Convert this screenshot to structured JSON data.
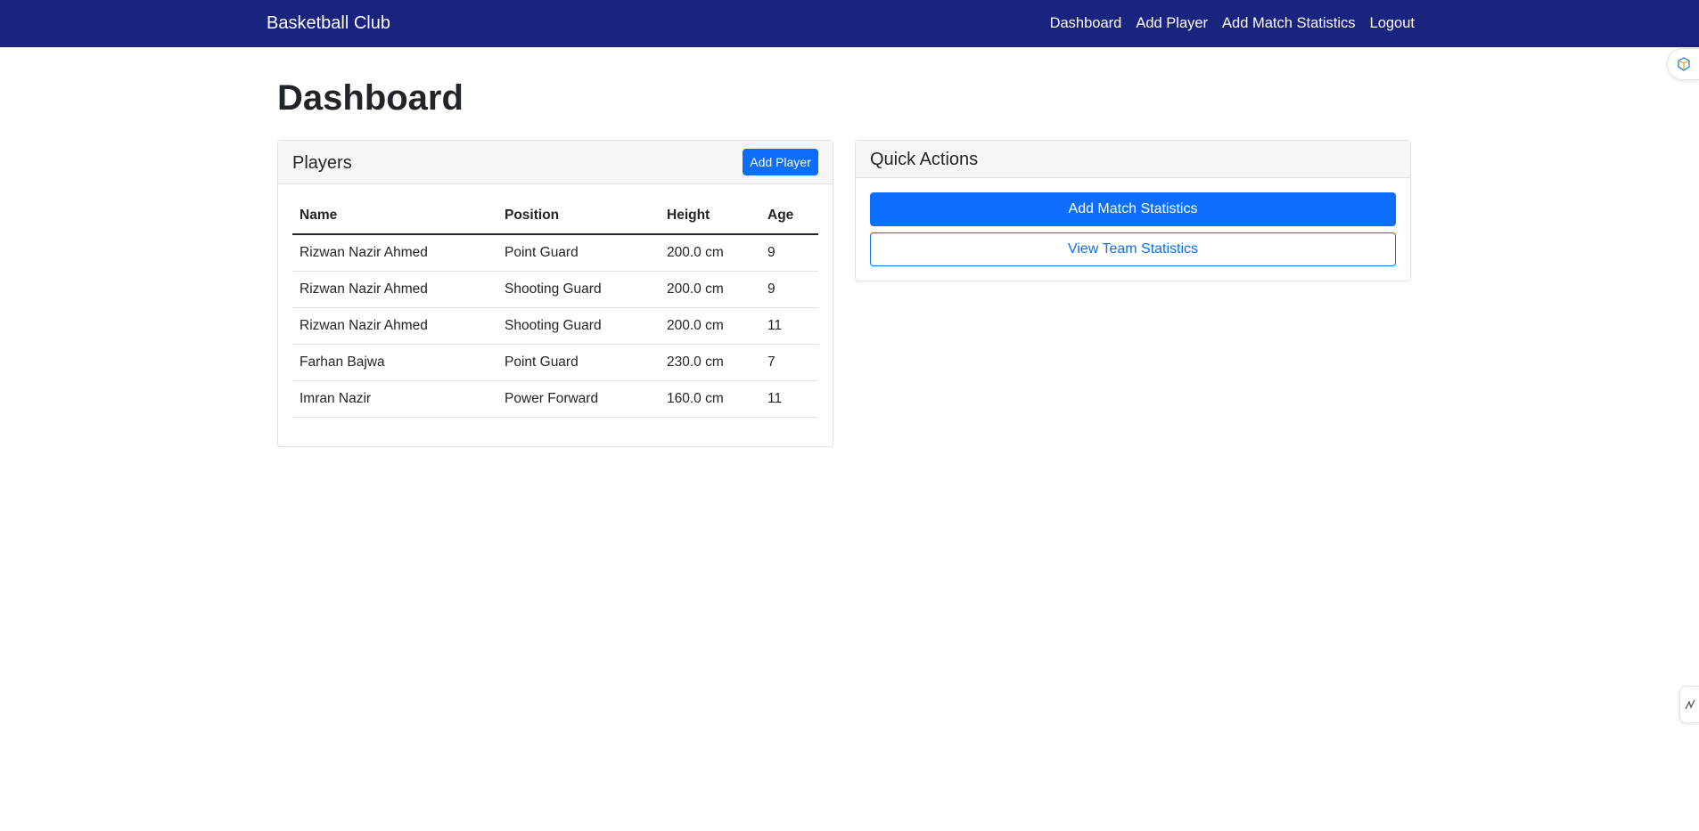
{
  "navbar": {
    "brand": "Basketball Club",
    "links": [
      "Dashboard",
      "Add Player",
      "Add Match Statistics",
      "Logout"
    ]
  },
  "page": {
    "title": "Dashboard"
  },
  "players_card": {
    "title": "Players",
    "add_button": "Add Player",
    "columns": [
      "Name",
      "Position",
      "Height",
      "Age"
    ],
    "rows": [
      [
        "Rizwan Nazir Ahmed",
        "Point Guard",
        "200.0 cm",
        "9"
      ],
      [
        "Rizwan Nazir Ahmed",
        "Shooting Guard",
        "200.0 cm",
        "9"
      ],
      [
        "Rizwan Nazir Ahmed",
        "Shooting Guard",
        "200.0 cm",
        "11"
      ],
      [
        "Farhan Bajwa",
        "Point Guard",
        "230.0 cm",
        "7"
      ],
      [
        "Imran Nazir",
        "Power Forward",
        "160.0 cm",
        "11"
      ]
    ]
  },
  "quick_actions": {
    "title": "Quick Actions",
    "primary_button": "Add Match Statistics",
    "secondary_button": "View Team Statistics"
  },
  "colors": {
    "navbar": "#1a237e",
    "primary": "#0d6efd"
  },
  "icons": {
    "side_tab_top": "extension-icon",
    "side_tab_bottom": "resize-handle-icon"
  }
}
